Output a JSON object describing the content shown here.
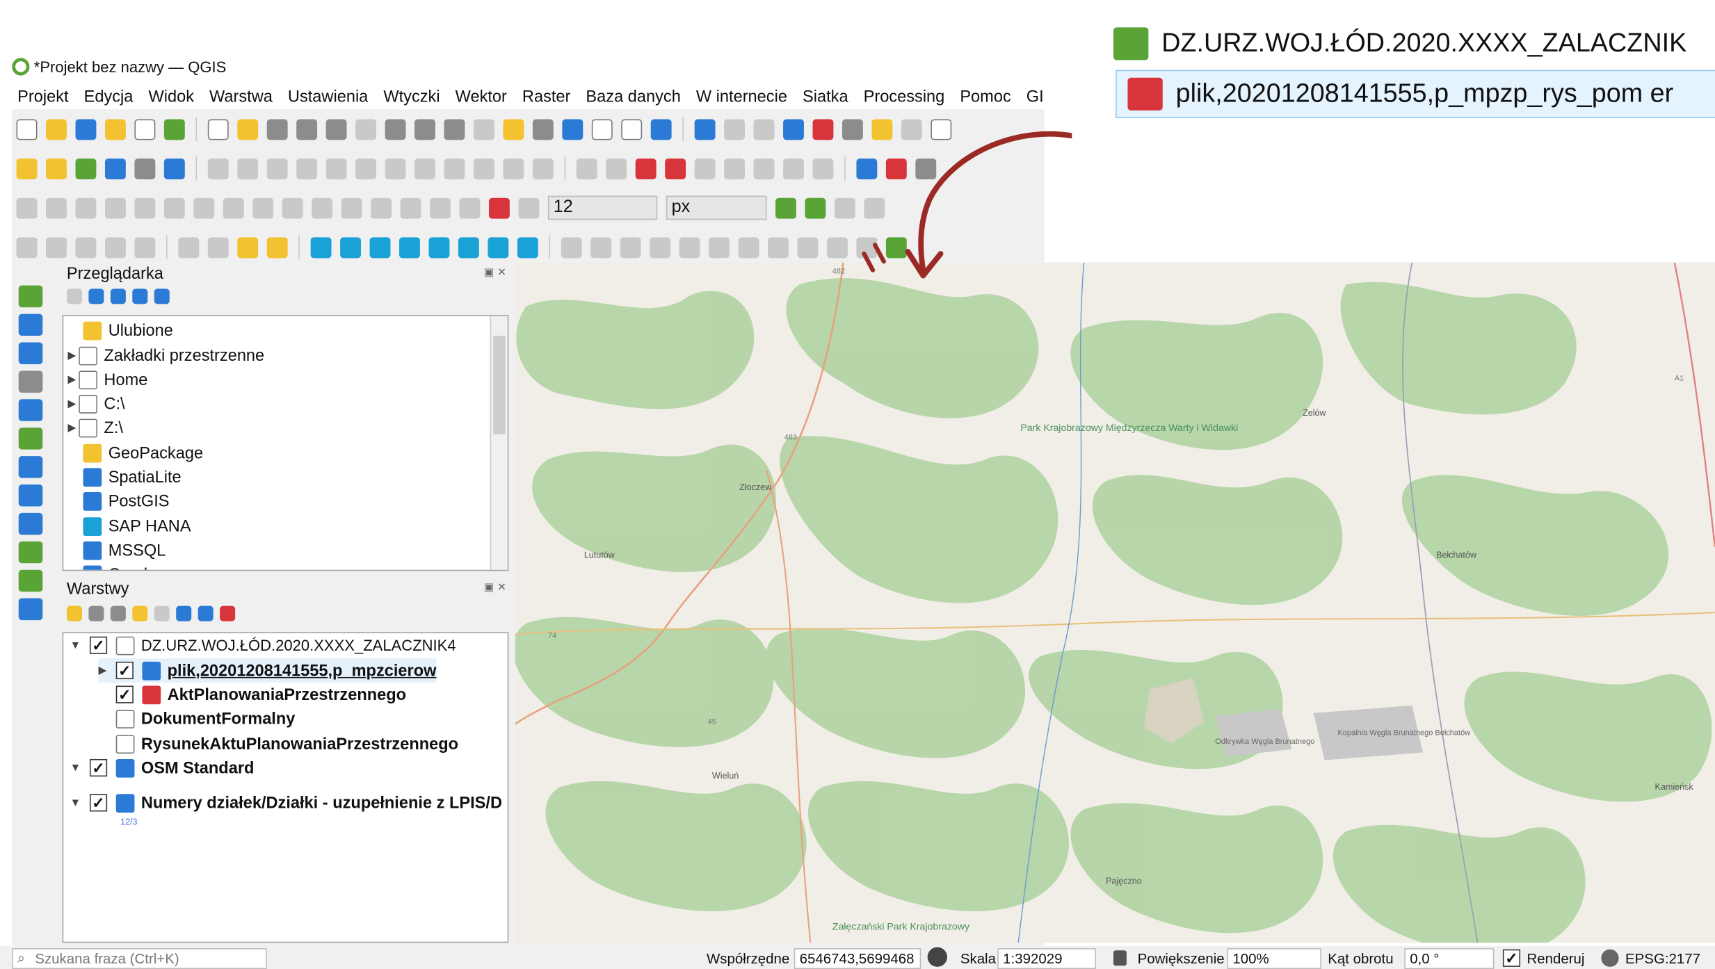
{
  "window": {
    "title": "*Projekt bez nazwy — QGIS"
  },
  "menu": [
    "Projekt",
    "Edycja",
    "Widok",
    "Warstwa",
    "Ustawienia",
    "Wtyczki",
    "Wektor",
    "Raster",
    "Baza danych",
    "W internecie",
    "Siatka",
    "Processing",
    "Pomoc",
    "GIS Su"
  ],
  "toolbar": {
    "size_value": "12",
    "unit_value": "px"
  },
  "browser_panel": {
    "title": "Przeglądarka",
    "items": [
      {
        "label": "Ulubione",
        "icon": "star-icon"
      },
      {
        "label": "Zakładki przestrzenne",
        "icon": "bookmark-icon"
      },
      {
        "label": "Home",
        "icon": "home-icon"
      },
      {
        "label": "C:\\",
        "icon": "folder-icon"
      },
      {
        "label": "Z:\\",
        "icon": "folder-icon"
      },
      {
        "label": "GeoPackage",
        "icon": "geopackage-icon"
      },
      {
        "label": "SpatiaLite",
        "icon": "spatialite-icon"
      },
      {
        "label": "PostGIS",
        "icon": "postgis-icon"
      },
      {
        "label": "SAP HANA",
        "icon": "sap-hana-icon"
      },
      {
        "label": "MSSQL",
        "icon": "mssql-icon"
      },
      {
        "label": "Oracle",
        "icon": "oracle-icon"
      }
    ]
  },
  "layers_panel": {
    "title": "Warstwy",
    "items": [
      {
        "label": "DZ.URZ.WOJ.ŁÓD.2020.XXXX_ZALACZNIK4",
        "icon": "gml-group-icon",
        "bold": false
      },
      {
        "label": "plik,20201208141555,p_mpzcierow",
        "icon": "raster-icon",
        "bold": true
      },
      {
        "label": "AktPlanowaniaPrzestrzennego",
        "icon": "polygon-layer-icon",
        "bold": true
      },
      {
        "label": "DokumentFormalny",
        "icon": "table-layer-icon",
        "bold": true
      },
      {
        "label": "RysunekAktuPlanowaniaPrzestrzennego",
        "icon": "table-layer-icon",
        "bold": true
      },
      {
        "label": "OSM Standard",
        "icon": "raster-icon",
        "bold": true
      },
      {
        "label": "Numery działek/Działki - uzupełnienie z LPIS/D",
        "icon": "raster-icon",
        "bold": true
      }
    ],
    "sublabel": "12/3"
  },
  "map_labels": {
    "park1": "Park Krajobrazowy Międzyrzecza Warty i Widawki",
    "park2": "Załęczański Park Krajobrazowy",
    "town1": "Złoczew",
    "town2": "Lututów",
    "town3": "Wieluń",
    "town4": "Bełchatów",
    "town5": "Zelów",
    "town6": "Pajęczno",
    "town7": "Kamieńsk",
    "mine1": "Odkrywka Węgla Brunatnego",
    "mine2": "Kopalnia Węgla Brunatnego Bełchatów",
    "road1": "482",
    "road2": "74",
    "road3": "45",
    "road4": "483",
    "road5": "A1"
  },
  "status_bar": {
    "search_placeholder": "Szukana fraza (Ctrl+K)",
    "coords_label": "Współrzędne",
    "coords_value": "6546743,5699468",
    "scale_label": "Skala",
    "scale_value": "1:392029",
    "zoom_label": "Powiększenie",
    "zoom_value": "100%",
    "rotation_label": "Kąt obrotu",
    "rotation_value": "0,0 °",
    "render_label": "Renderuj",
    "crs_value": "EPSG:2177"
  },
  "explorer": {
    "files": [
      {
        "label": "DZ.URZ.WOJ.ŁÓD.2020.XXXX_ZALACZNIK",
        "icon": "document-icon"
      },
      {
        "label": "plik,20201208141555,p_mpzp_rys_pom er",
        "icon": "image-file-icon"
      }
    ]
  },
  "colors": {
    "accent": "#5aa336",
    "map_background": "#f1eee7",
    "forest": "#add19e",
    "road": "#e8a07d",
    "arrow": "#9b2a25"
  }
}
